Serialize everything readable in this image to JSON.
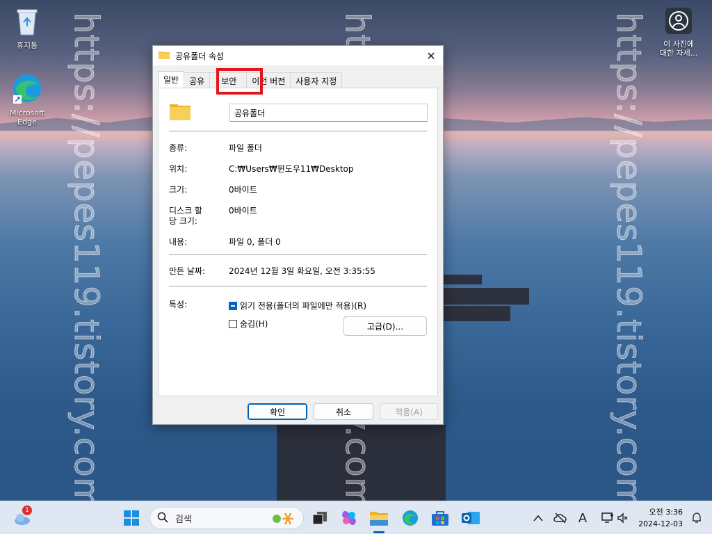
{
  "desktop": {
    "watermark": "https://pepes119.tistory.com/",
    "icons": {
      "recycle_bin": "휴지통",
      "edge_line1": "Microsoft",
      "edge_line2": "Edge",
      "photo_info_line1": "이 사진에",
      "photo_info_line2": "대한 자세..."
    }
  },
  "dialog": {
    "title": "공유폴더 속성",
    "tabs": [
      "일반",
      "공유",
      "보안",
      "이전 버전",
      "사용자 지정"
    ],
    "name_value": "공유폴더",
    "rows": {
      "type_label": "종류:",
      "type_value": "파일 폴더",
      "location_label": "위치:",
      "location_value": "C:₩Users₩윈도우11₩Desktop",
      "size_label": "크기:",
      "size_value": "0바이트",
      "disk_size_label_1": "디스크 할",
      "disk_size_label_2": "당 크기:",
      "disk_size_value": "0바이트",
      "contents_label": "내용:",
      "contents_value": "파일 0, 폴더 0",
      "created_label": "만든 날짜:",
      "created_value": "2024년 12월 3일 화요일, 오전 3:35:55",
      "attributes_label": "특성:"
    },
    "readonly_label": "읽기 전용(폴더의 파일에만 적용)(R)",
    "hidden_label": "숨김(H)",
    "advanced_label": "고급(D)...",
    "ok_label": "확인",
    "cancel_label": "취소",
    "apply_label": "적용(A)"
  },
  "taskbar": {
    "search_label": "검색",
    "weather_badge": "1",
    "time": "오전 3:36",
    "date": "2024-12-03",
    "ime_letter": "A"
  },
  "colors": {
    "accent": "#0067c0",
    "highlight": "#e5141c",
    "folder": "#f4c542"
  }
}
